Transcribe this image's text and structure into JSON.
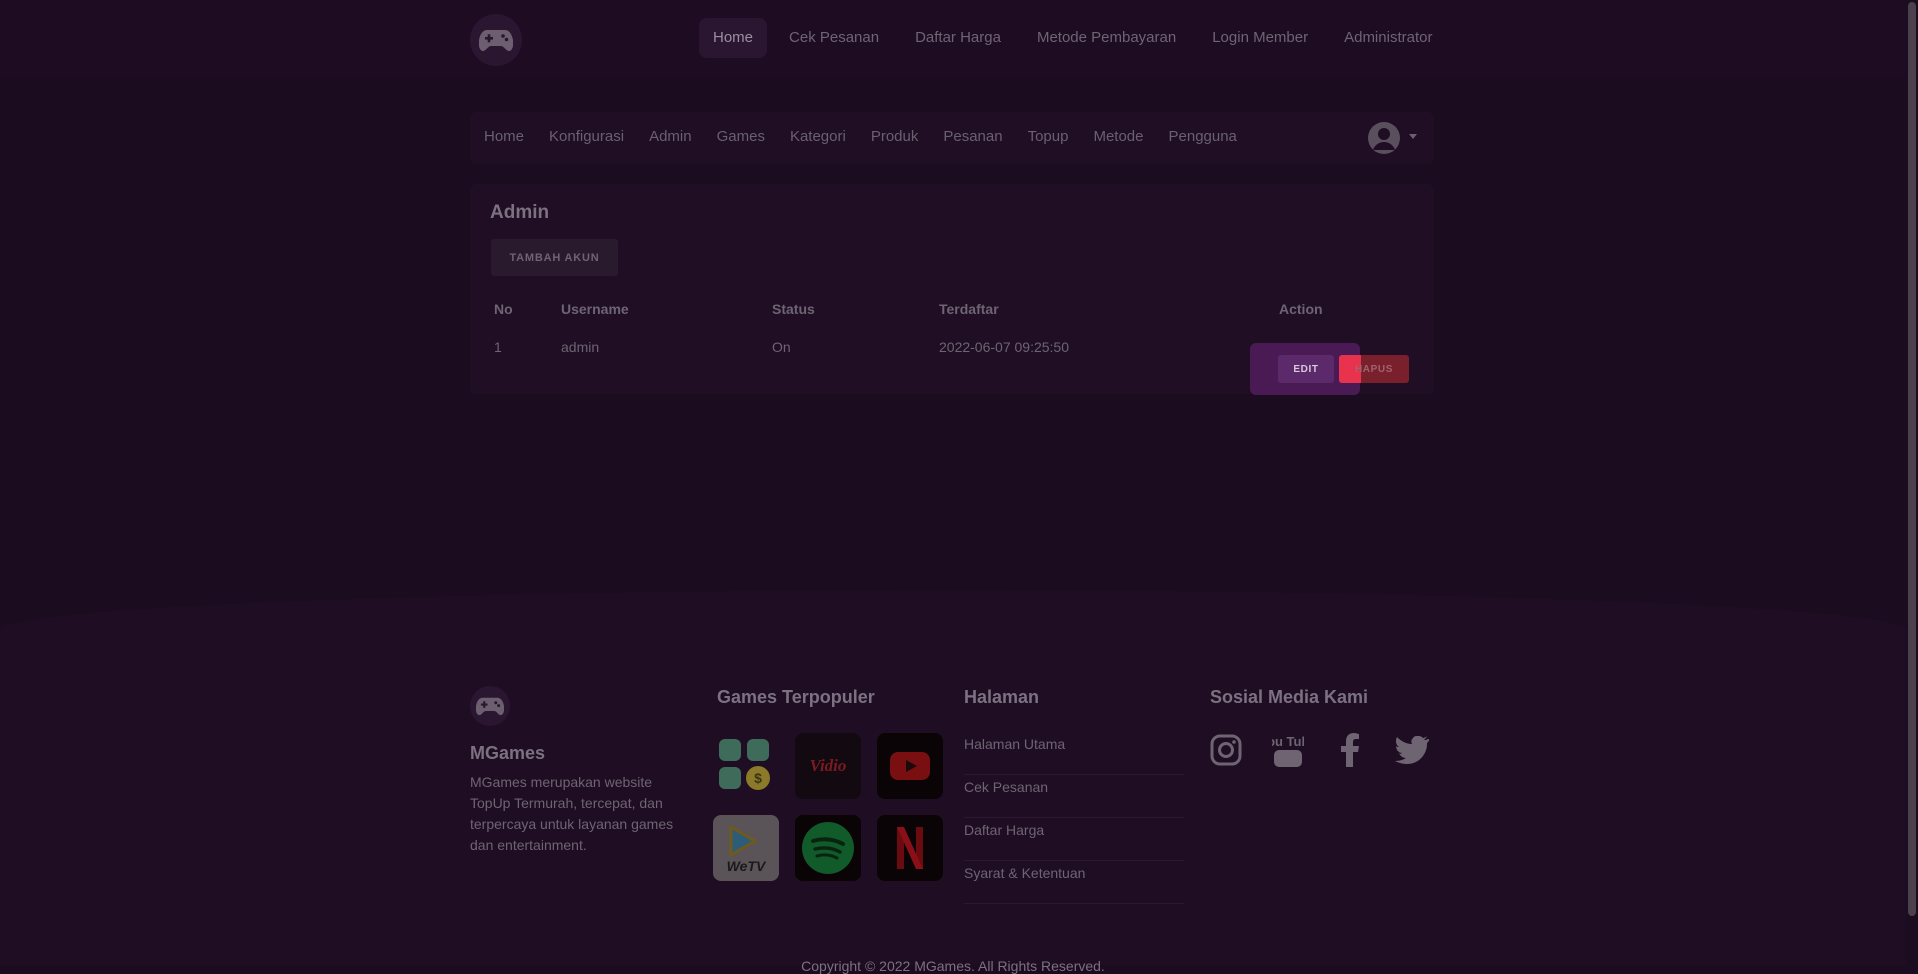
{
  "topnav": {
    "items": [
      "Home",
      "Cek Pesanan",
      "Daftar Harga",
      "Metode Pembayaran",
      "Login Member",
      "Administrator"
    ]
  },
  "subnav": {
    "items": [
      "Home",
      "Konfigurasi",
      "Admin",
      "Games",
      "Kategori",
      "Produk",
      "Pesanan",
      "Topup",
      "Metode",
      "Pengguna"
    ]
  },
  "admin": {
    "title": "Admin",
    "add_button": "TAMBAH AKUN",
    "columns": [
      "No",
      "Username",
      "Status",
      "Terdaftar",
      "Action"
    ],
    "rows": [
      {
        "no": "1",
        "username": "admin",
        "status": "On",
        "registered": "2022-06-07 09:25:50"
      }
    ],
    "edit_label": "EDIT",
    "delete_label": "HAPUS"
  },
  "footer": {
    "brand": "MGames",
    "description": "MGames merupakan website TopUp Termurah, tercepat, dan terpercaya untuk layanan games dan entertainment.",
    "games_heading": "Games Terpopuler",
    "pages_heading": "Halaman",
    "pages": [
      "Halaman Utama",
      "Cek Pesanan",
      "Daftar Harga",
      "Syarat & Ketentuan"
    ],
    "social_heading": "Sosial Media Kami",
    "game_icons": [
      "apps-coin-icon",
      "vidio-icon",
      "youtube-icon",
      "wetv-icon",
      "spotify-icon",
      "netflix-icon"
    ],
    "social_icons": [
      "instagram-icon",
      "youtube-icon",
      "facebook-icon",
      "twitter-icon"
    ],
    "vidio_text": "Vidio",
    "wetv_text": "WeTV",
    "youtube_text": "You Tube",
    "copyright": "Copyright © 2022 MGames. All Rights Reserved."
  }
}
